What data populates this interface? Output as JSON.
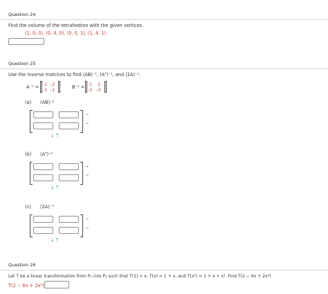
{
  "q24": {
    "title": "Question 24",
    "prompt": "Find the volume of the tetrahedron with the given vertices.",
    "vertices": "(1, 0, 0), (0, 4, 0), (0, 0, 1), (1, 4, 1)",
    "answer": ""
  },
  "q25": {
    "title": "Question 25",
    "prompt": "Use the inverse matrices to find (AB)⁻¹, (Aᵀ)⁻¹, and (2A)⁻¹.",
    "a_label": "A⁻¹ =",
    "b_label": "B⁻¹ =",
    "a_inv": {
      "r1c1": "1",
      "r1c2": "-2",
      "r2c1": "1",
      "r2c2": "-1"
    },
    "b_inv": {
      "r1c1": "1",
      "r1c2": "2",
      "r2c1": "-2",
      "r2c2": "-3"
    },
    "parts": [
      {
        "letter": "(a)",
        "expr": "(AB)⁻¹"
      },
      {
        "letter": "(b)",
        "expr": "(Aᵀ)⁻¹"
      },
      {
        "letter": "(c)",
        "expr": "(2A)⁻¹"
      }
    ],
    "row_arrow": "⇢",
    "col_arrows": "⇣⇡"
  },
  "q26": {
    "title": "Question 26",
    "prompt": "Let T be a linear transformation from P₂ into P₂ such that  T(1) = x, T(x) = 1 + x, and T(x²) = 1 + x + x². Find  T(2 − 6x + 2x²)",
    "answer_label": "T(2 − 6x + 2x²) =",
    "answer": ""
  }
}
